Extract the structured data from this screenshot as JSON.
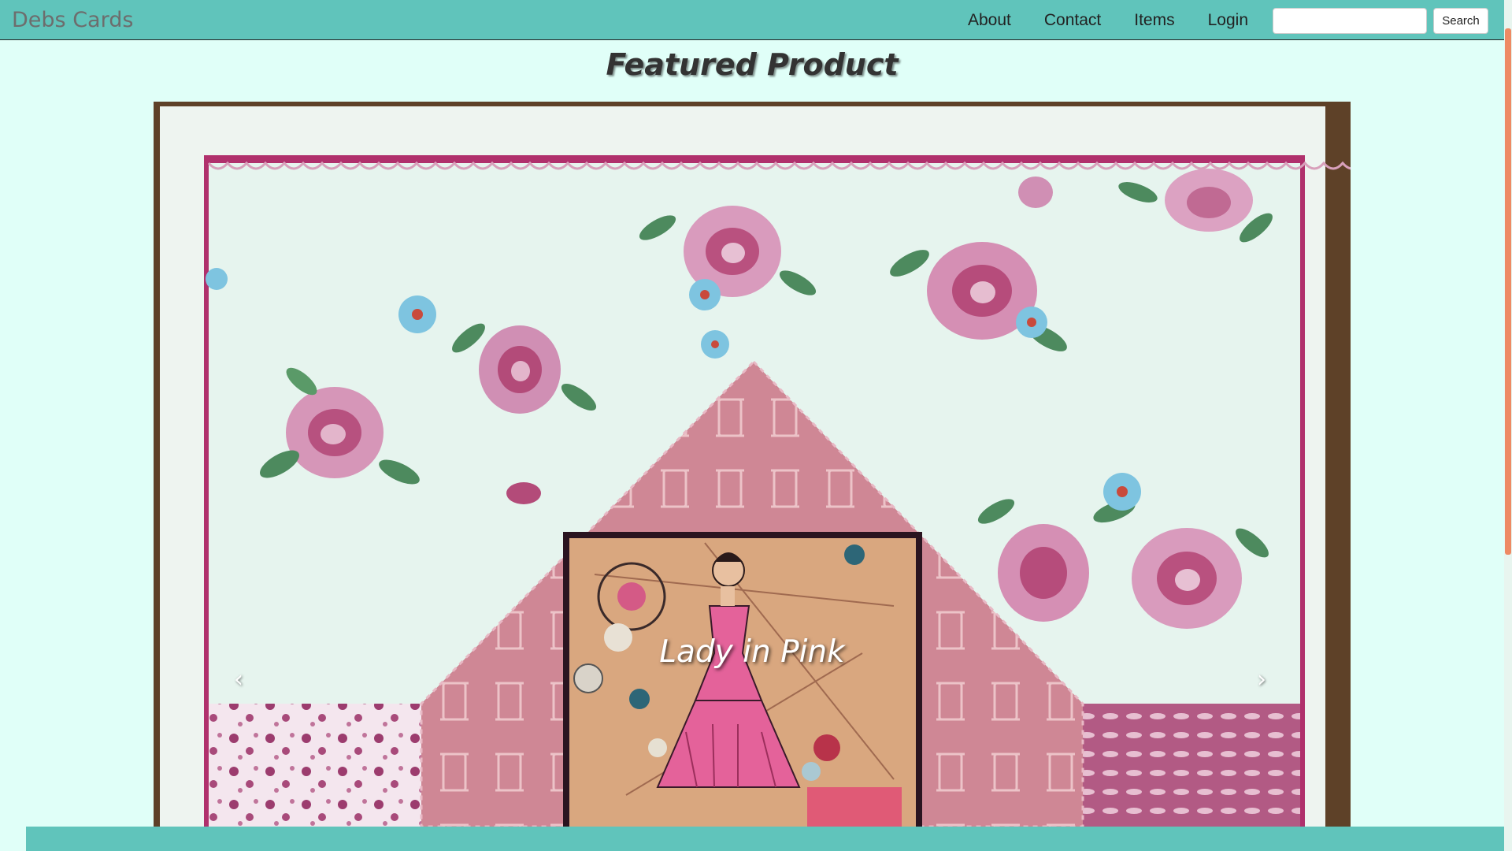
{
  "navbar": {
    "brand": "Debs Cards",
    "links": [
      "About",
      "Contact",
      "Items",
      "Login"
    ],
    "search_placeholder": "",
    "search_button": "Search"
  },
  "main": {
    "title": "Featured Product",
    "carousel": {
      "caption": "Lady in Pink",
      "prev_icon": "chevron-left-icon",
      "next_icon": "chevron-right-icon"
    }
  },
  "colors": {
    "navbar": "#60c4bb",
    "background": "#e0fff8",
    "scrollbar_thumb": "#ee8a64"
  }
}
